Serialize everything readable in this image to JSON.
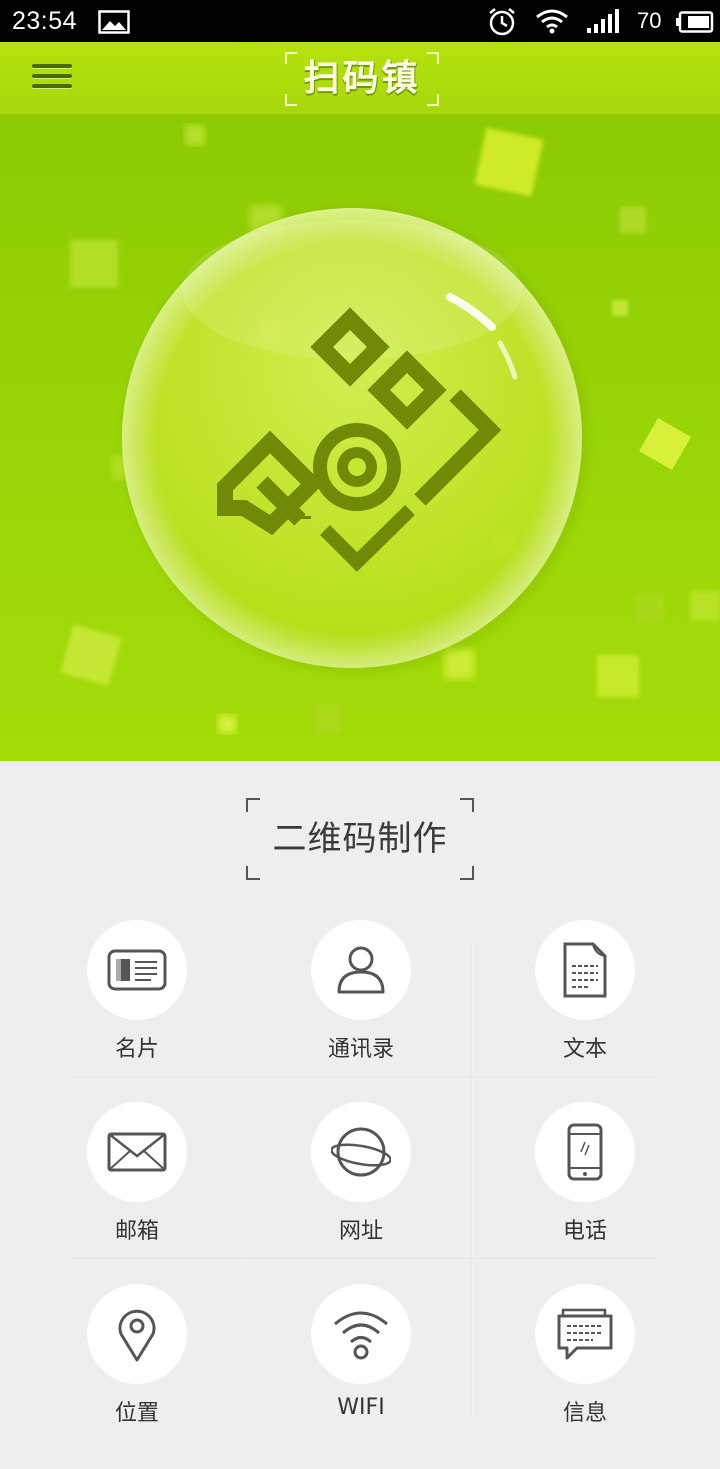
{
  "status_bar": {
    "time": "23:54",
    "battery": "70",
    "icons": [
      "image-icon",
      "alarm-icon",
      "wifi-icon",
      "signal-icon",
      "battery-icon"
    ]
  },
  "app_bar": {
    "title": "扫码镇",
    "menu_icon": "hamburger-menu-icon",
    "colors": {
      "bar": "#b6e20e",
      "title": "#fffbe0"
    }
  },
  "hero": {
    "logo_icon": "qr-camera-logo-icon",
    "colors": {
      "background": "#9ad607",
      "logo": "#6e8a07"
    }
  },
  "section": {
    "title": "二维码制作"
  },
  "grid": {
    "items": [
      {
        "label": "名片",
        "icon": "business-card-icon"
      },
      {
        "label": "通讯录",
        "icon": "contact-icon"
      },
      {
        "label": "文本",
        "icon": "document-icon"
      },
      {
        "label": "邮箱",
        "icon": "envelope-icon"
      },
      {
        "label": "网址",
        "icon": "planet-globe-icon"
      },
      {
        "label": "电话",
        "icon": "phone-icon"
      },
      {
        "label": "位置",
        "icon": "location-pin-icon"
      },
      {
        "label": "WIFI",
        "icon": "wifi-icon"
      },
      {
        "label": "信息",
        "icon": "message-bubble-icon"
      }
    ]
  }
}
